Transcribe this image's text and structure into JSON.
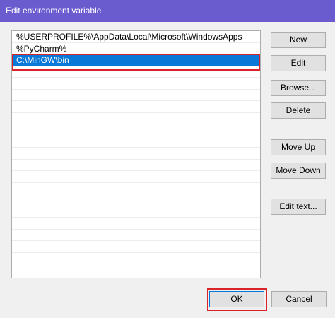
{
  "window": {
    "title": "Edit environment variable"
  },
  "list": {
    "items": [
      "%USERPROFILE%\\AppData\\Local\\Microsoft\\WindowsApps",
      "%PyCharm%",
      "C:\\MinGW\\bin"
    ],
    "selected_index": 2
  },
  "buttons": {
    "new": "New",
    "edit": "Edit",
    "browse": "Browse...",
    "delete": "Delete",
    "move_up": "Move Up",
    "move_down": "Move Down",
    "edit_text": "Edit text...",
    "ok": "OK",
    "cancel": "Cancel"
  },
  "colors": {
    "title_bar": "#6a5ccf",
    "selection": "#0a78d7",
    "annotation_highlight": "#d8232a"
  }
}
